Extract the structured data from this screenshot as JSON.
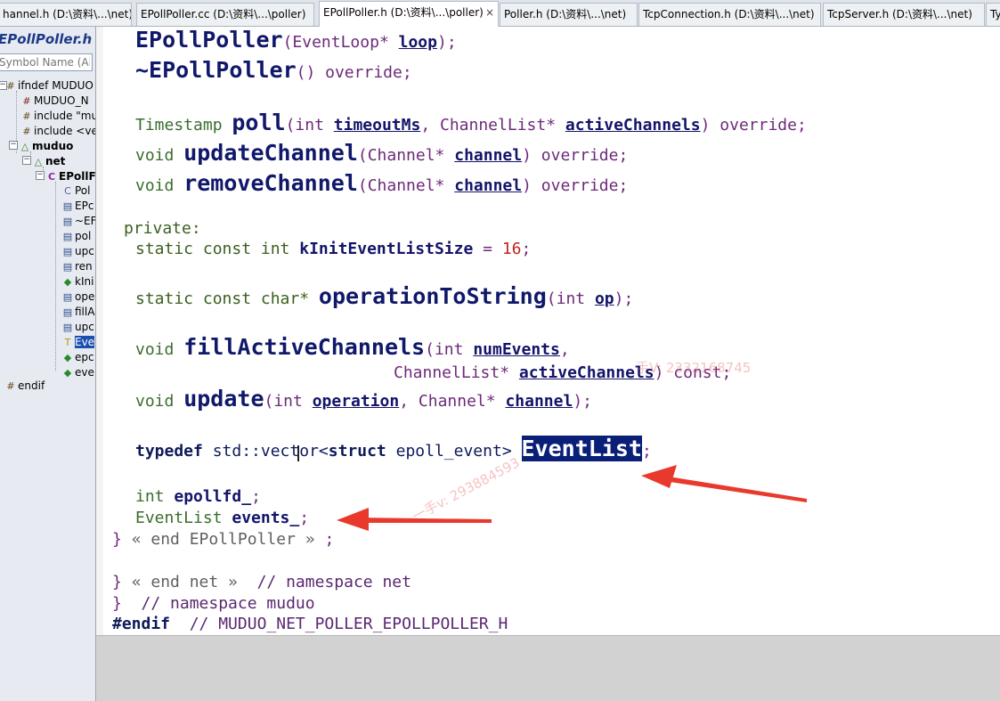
{
  "tabs": [
    {
      "label": "hannel.h (D:\\资料\\...\\net)"
    },
    {
      "label": "EPollPoller.cc (D:\\资料\\...\\poller)"
    },
    {
      "label": "EPollPoller.h (D:\\资料\\...\\poller)",
      "active": true
    },
    {
      "label": "Poller.h (D:\\资料\\...\\net)"
    },
    {
      "label": "TcpConnection.h (D:\\资料\\...\\net)"
    },
    {
      "label": "TcpServer.h (D:\\资料\\...\\net)"
    },
    {
      "label": "Ty"
    }
  ],
  "tab_close_glyph": "×",
  "sidebar": {
    "title": "EPollPoller.h",
    "search_placeholder": "Symbol Name (Alt",
    "nodes": [
      {
        "label": "ifndef MUDUO",
        "icon": "hash-icon"
      },
      {
        "label": "MUDUO_N",
        "icon": "define-icon"
      },
      {
        "label": "include \"mu",
        "icon": "include-icon"
      },
      {
        "label": "include <ve",
        "icon": "include-icon"
      },
      {
        "label": "muduo",
        "icon": "namespace-icon"
      },
      {
        "label": "net",
        "icon": "namespace-icon"
      },
      {
        "label": "EPollF",
        "icon": "class-icon"
      },
      {
        "label": "Pol",
        "icon": "class-icon"
      },
      {
        "label": "EPc",
        "icon": "method-icon"
      },
      {
        "label": "~EF",
        "icon": "method-icon"
      },
      {
        "label": "pol",
        "icon": "method-icon"
      },
      {
        "label": "upc",
        "icon": "method-icon"
      },
      {
        "label": "ren",
        "icon": "method-icon"
      },
      {
        "label": "kIni",
        "icon": "member-icon"
      },
      {
        "label": "ope",
        "icon": "method-icon"
      },
      {
        "label": "fillA",
        "icon": "method-icon"
      },
      {
        "label": "upc",
        "icon": "method-icon"
      },
      {
        "label": "Eve",
        "icon": "typedef-icon",
        "selected": true
      },
      {
        "label": "epc",
        "icon": "member-icon"
      },
      {
        "label": "eve",
        "icon": "member-icon"
      },
      {
        "label": "endif",
        "icon": "hash-icon"
      }
    ]
  },
  "code": {
    "l1": {
      "fn": "EPollPoller",
      "p1": "(EventLoop* ",
      "par": "loop",
      "p2": ");"
    },
    "l2": {
      "fn": "~EPollPoller",
      "p1": "() override;"
    },
    "l3": {
      "a": "Timestamp ",
      "fn": "poll",
      "b": "(int ",
      "p1": "timeoutMs",
      "c": ", ChannelList* ",
      "p2": "activeChannels",
      "d": ") override;"
    },
    "l4": {
      "a": "void ",
      "fn": "updateChannel",
      "b": "(Channel* ",
      "p1": "channel",
      "d": ") override;"
    },
    "l5": {
      "a": "void ",
      "fn": "removeChannel",
      "b": "(Channel* ",
      "p1": "channel",
      "d": ") override;"
    },
    "l6": {
      "a": "private:"
    },
    "l7": {
      "a": "static const int ",
      "id": "kInitEventListSize",
      "b": " = ",
      "num": "16",
      "c": ";"
    },
    "l8": {
      "a": "static const char* ",
      "fn": "operationToString",
      "b": "(int ",
      "p1": "op",
      "c": ");"
    },
    "l9": {
      "a": "void ",
      "fn": "fillActiveChannels",
      "b": "(int ",
      "p1": "numEvents",
      "c": ","
    },
    "l10": {
      "a": "ChannelList* ",
      "p1": "activeChannels",
      "c": ") const;"
    },
    "l11": {
      "a": "void ",
      "fn": "update",
      "b": "(int ",
      "p1": "operation",
      "c": ", Channel* ",
      "p2": "channel",
      "d": ");"
    },
    "l12": {
      "a": "typedef ",
      "b": "std::vector<",
      "c": "struct ",
      "d": "epoll_event> ",
      "hl": "EventList",
      "e": ";"
    },
    "l13": {
      "a": "int ",
      "id": "epollfd_",
      "c": ";"
    },
    "l14": {
      "a": "EventList ",
      "id": "events_",
      "c": ";"
    },
    "l15": {
      "a": "} ",
      "dim": "« end EPollPoller » ",
      "c": ";"
    },
    "l16": {
      "a": "} ",
      "dim": "« end net »",
      "cm": "  // namespace net"
    },
    "l17": {
      "a": "}",
      "cm": "  // namespace muduo"
    },
    "l18": {
      "a": "#endif",
      "cm": "  // MUDUO_NET_POLLER_EPOLLPOLLER_H"
    }
  },
  "watermark": [
    "手V: 2332168745",
    "一手v: 293884593"
  ],
  "colors": {
    "accent_selection": "#0a1f78",
    "arrow": "#e8392c"
  }
}
